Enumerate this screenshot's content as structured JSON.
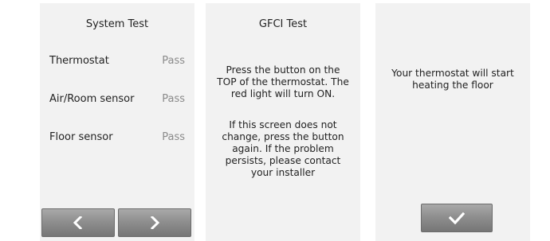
{
  "system_test": {
    "title": "System Test",
    "rows": [
      {
        "name": "Thermostat",
        "result": "Pass"
      },
      {
        "name": "Air/Room sensor",
        "result": "Pass"
      },
      {
        "name": "Floor sensor",
        "result": "Pass"
      }
    ],
    "back_icon": "chevron-left-icon",
    "next_icon": "chevron-right-icon"
  },
  "gfci_test": {
    "title": "GFCI Test",
    "instruction": "Press the button on the TOP of the thermostat. The red light will turn ON.",
    "note": "If this screen does not change, press the button again. If the problem persists, please contact your installer"
  },
  "heating": {
    "message": "Your thermostat will start heating the floor",
    "confirm_icon": "checkmark-icon"
  },
  "colors": {
    "panel_bg": "#f2f2f2",
    "button_bg": "#8f8f8f",
    "result_text": "#8a8a8a",
    "icon": "#ffffff"
  }
}
